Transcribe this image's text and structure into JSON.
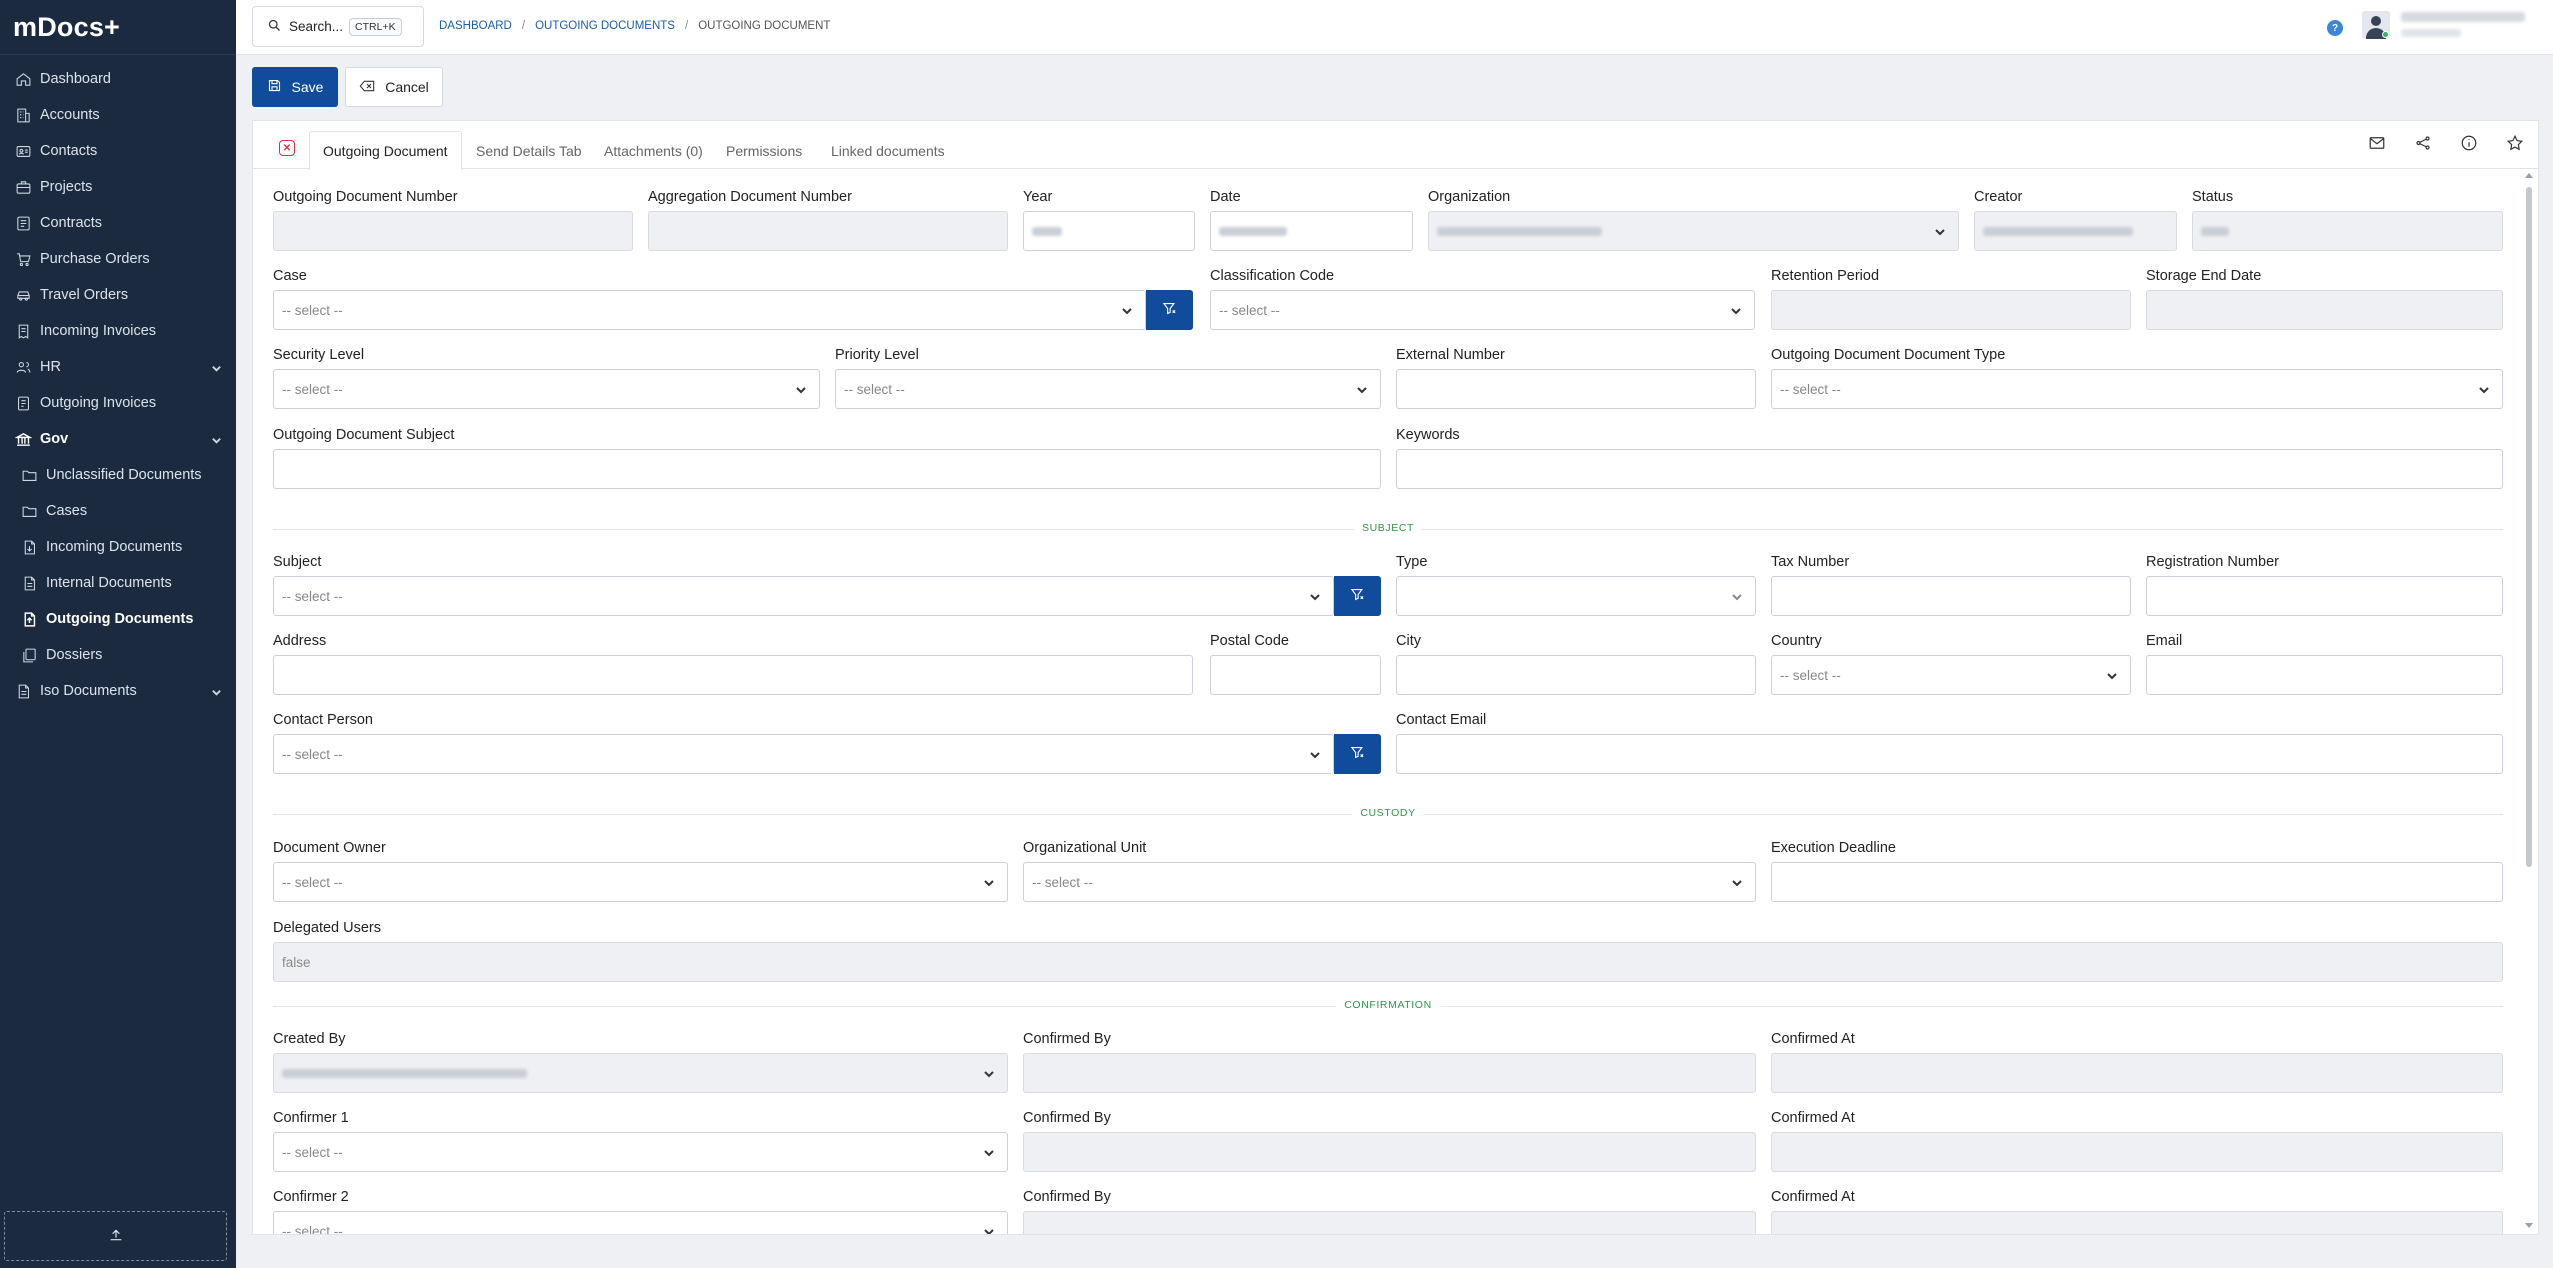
{
  "app": {
    "logo": "mDocs+"
  },
  "sidebar": {
    "items": [
      {
        "label": "Dashboard",
        "icon": "home-icon"
      },
      {
        "label": "Accounts",
        "icon": "building-icon"
      },
      {
        "label": "Contacts",
        "icon": "contact-card-icon"
      },
      {
        "label": "Projects",
        "icon": "briefcase-icon"
      },
      {
        "label": "Contracts",
        "icon": "contract-icon"
      },
      {
        "label": "Purchase Orders",
        "icon": "cart-icon"
      },
      {
        "label": "Travel Orders",
        "icon": "car-icon"
      },
      {
        "label": "Incoming Invoices",
        "icon": "invoice-icon"
      },
      {
        "label": "HR",
        "icon": "users-icon"
      },
      {
        "label": "Outgoing Invoices",
        "icon": "invoice-out-icon"
      },
      {
        "label": "Gov",
        "icon": "bank-icon"
      },
      {
        "label": "Unclassified Documents",
        "icon": "folder-icon"
      },
      {
        "label": "Cases",
        "icon": "folder-icon"
      },
      {
        "label": "Incoming Documents",
        "icon": "document-in-icon"
      },
      {
        "label": "Internal Documents",
        "icon": "document-icon"
      },
      {
        "label": "Outgoing Documents",
        "icon": "document-out-icon"
      },
      {
        "label": "Dossiers",
        "icon": "stack-icon"
      },
      {
        "label": "Iso Documents",
        "icon": "document-icon"
      }
    ]
  },
  "topbar": {
    "search_label": "Search...",
    "search_shortcut": "CTRL+K",
    "breadcrumb": [
      "DASHBOARD",
      "OUTGOING DOCUMENTS",
      "OUTGOING DOCUMENT"
    ],
    "help": "?"
  },
  "actions": {
    "save": "Save",
    "cancel": "Cancel"
  },
  "tabs": [
    "Outgoing Document",
    "Send Details Tab",
    "Attachments (0)",
    "Permissions",
    "Linked documents"
  ],
  "select_placeholder": "-- select --",
  "labels": {
    "outgoing_number": "Outgoing Document Number",
    "aggregation_number": "Aggregation Document Number",
    "year": "Year",
    "date": "Date",
    "organization": "Organization",
    "creator": "Creator",
    "status": "Status",
    "case": "Case",
    "classification_code": "Classification Code",
    "retention_period": "Retention Period",
    "storage_end_date": "Storage End Date",
    "security_level": "Security Level",
    "priority_level": "Priority Level",
    "external_number": "External Number",
    "doc_type": "Outgoing Document Document Type",
    "subject_field": "Outgoing Document Subject",
    "keywords": "Keywords",
    "subject": "Subject",
    "type": "Type",
    "tax_number": "Tax Number",
    "registration_number": "Registration Number",
    "address": "Address",
    "postal_code": "Postal Code",
    "city": "City",
    "country": "Country",
    "email": "Email",
    "contact_person": "Contact Person",
    "contact_email": "Contact Email",
    "document_owner": "Document Owner",
    "org_unit": "Organizational Unit",
    "execution_deadline": "Execution Deadline",
    "delegated_users": "Delegated Users",
    "created_by": "Created By",
    "confirmed_by": "Confirmed By",
    "confirmed_at": "Confirmed At",
    "confirmer_1": "Confirmer 1",
    "confirmer_2": "Confirmer 2"
  },
  "values": {
    "delegated_users": "false"
  },
  "sections": {
    "subject": "SUBJECT",
    "custody": "CUSTODY",
    "confirmation": "CONFIRMATION"
  },
  "colors": {
    "sidebar_bg": "#1b2a3e",
    "primary": "#114b9b",
    "section": "#2c9a43",
    "danger": "#d9333f"
  }
}
